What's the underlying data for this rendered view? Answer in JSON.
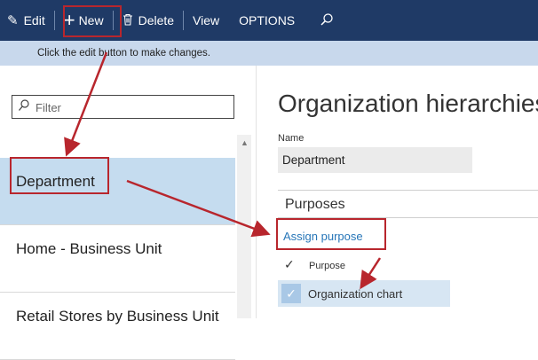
{
  "toolbar": {
    "edit_label": "Edit",
    "new_label": "New",
    "delete_label": "Delete",
    "view_label": "View",
    "options_label": "OPTIONS"
  },
  "infobar": {
    "message": "Click the edit button to make changes."
  },
  "filter": {
    "placeholder": "Filter"
  },
  "list": {
    "items": [
      {
        "label": "Department"
      },
      {
        "label": "Home - Business Unit"
      },
      {
        "label": "Retail Stores by Business Unit"
      }
    ]
  },
  "detail": {
    "title": "Organization hierarchies",
    "name_label": "Name",
    "name_value": "Department",
    "purposes_title": "Purposes",
    "assign_link": "Assign purpose",
    "grid_header": "Purpose",
    "grid_rows": [
      {
        "purpose": "Organization chart"
      }
    ]
  },
  "colors": {
    "toolbar_bg": "#1f3a66",
    "infobar_bg": "#c8d8ec",
    "selected_row": "#c5dcef",
    "link": "#2776b8",
    "callout": "#b8262d"
  }
}
